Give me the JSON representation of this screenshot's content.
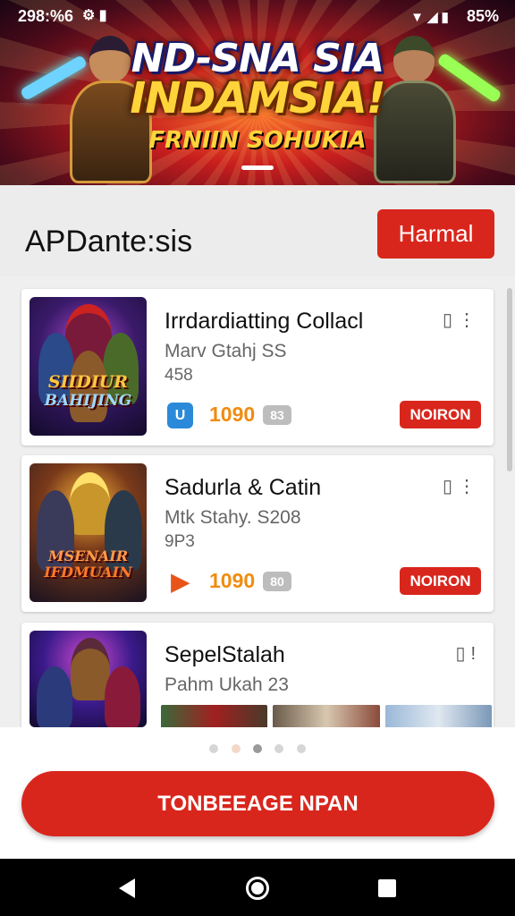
{
  "status_bar": {
    "time": "298:%6",
    "right_text": "85%",
    "icons": [
      "settings-icon",
      "bag-icon",
      "wifi-icon",
      "signal-icon",
      "battery-icon"
    ]
  },
  "banner": {
    "title_line1": "ND-SNA SIA",
    "title_line2": "INDAMSIA!",
    "title_line3": "FRNIIN SOHUKIA"
  },
  "header": {
    "title": "APDante:sis",
    "button_label": "Harmal"
  },
  "cards": [
    {
      "name": "Irrdardiatting Collacl",
      "subtitle": "Marv Gtahj SS",
      "number": "458",
      "thumb_text_line1": "SIIDIUR",
      "thumb_text_line2": "BAHIJING",
      "app_icon": "store-icon",
      "price": "1090",
      "pill": "83",
      "action_label": "NOIRON"
    },
    {
      "name": "Sadurla & Catin",
      "subtitle": "Mtk Stahy. S208",
      "number": "9P3",
      "thumb_text_line1": "MSENAIR",
      "thumb_text_line2": "IFDMUAIN",
      "app_icon": "play-icon",
      "price": "1090",
      "pill": "80",
      "action_label": "NOIRON"
    },
    {
      "name": "SepelStalah",
      "subtitle": "Pahm Ukah 23",
      "number": ""
    }
  ],
  "cta_label": "TONBEEAGE NPAN",
  "colors": {
    "accent": "#d9261c",
    "price": "#f08c10"
  }
}
